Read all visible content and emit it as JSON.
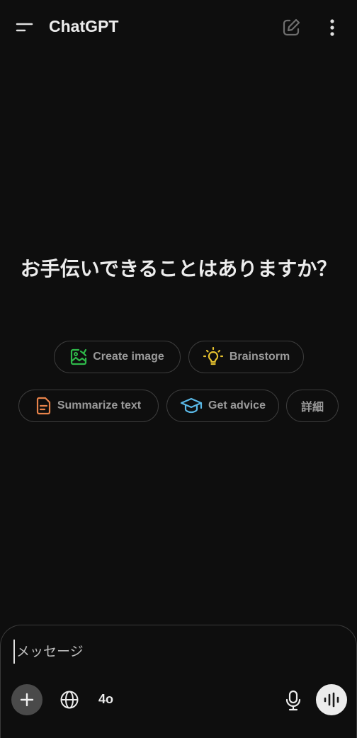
{
  "header": {
    "title": "ChatGPT",
    "menu_icon": "menu-icon",
    "new_chat_icon": "edit-icon",
    "more_icon": "more-vertical-icon"
  },
  "main": {
    "headline": "お手伝いできることはありますか？"
  },
  "suggestions": [
    {
      "label": "Create image",
      "icon": "image-create-icon",
      "color": "#2fb94a"
    },
    {
      "label": "Brainstorm",
      "icon": "lightbulb-icon",
      "color": "#e6c22f"
    },
    {
      "label": "Summarize text",
      "icon": "document-icon",
      "color": "#e8834a"
    },
    {
      "label": "Get advice",
      "icon": "graduation-cap-icon",
      "color": "#5ab8e6"
    },
    {
      "label": "詳細",
      "icon": "",
      "color": ""
    }
  ],
  "composer": {
    "placeholder": "メッセージ",
    "value": "",
    "model_label": "4o",
    "attach_icon": "plus-icon",
    "search_icon": "globe-icon",
    "mic_icon": "microphone-icon",
    "voice_icon": "voice-waveform-icon"
  }
}
